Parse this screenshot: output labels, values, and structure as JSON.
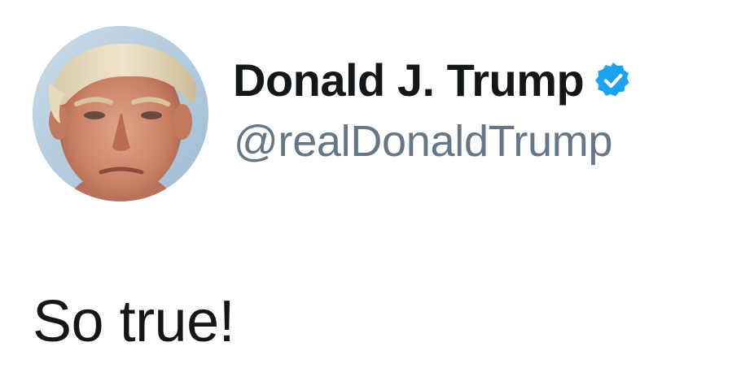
{
  "tweet": {
    "author": {
      "display_name": "Donald J. Trump",
      "handle": "@realDonaldTrump",
      "verified": true,
      "avatar_icon": "profile-photo",
      "verified_icon": "verified-badge-icon"
    },
    "text": "So true!"
  },
  "colors": {
    "name_text": "#14171a",
    "handle_text": "#657786",
    "verified_badge": "#1da1f2",
    "background": "#ffffff"
  }
}
